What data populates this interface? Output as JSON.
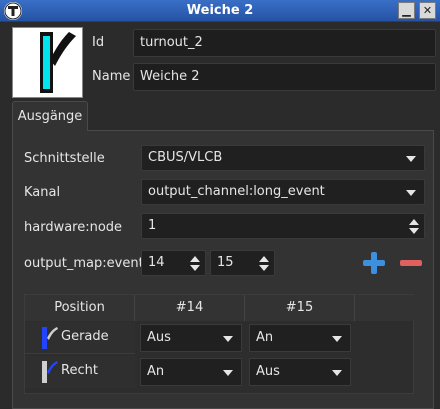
{
  "window": {
    "title": "Weiche 2"
  },
  "fields": {
    "id_label": "Id",
    "id_value": "turnout_2",
    "name_label": "Name",
    "name_value": "Weiche 2"
  },
  "tab": {
    "label": "Ausgänge"
  },
  "form": {
    "interface_label": "Schnittstelle",
    "interface_value": "CBUS/VLCB",
    "channel_label": "Kanal",
    "channel_value": "output_channel:long_event",
    "hardware_label": "hardware:node",
    "hardware_value": "1",
    "output_map_label": "output_map:events",
    "event1": "14",
    "event2": "15"
  },
  "table": {
    "headers": [
      "Position",
      "#14",
      "#15"
    ],
    "rows": [
      {
        "label": "Gerade",
        "c1": "Aus",
        "c2": "An"
      },
      {
        "label": "Recht",
        "c1": "An",
        "c2": "Aus"
      }
    ]
  },
  "colors": {
    "titlebar": "#2553a4",
    "add": "#3d8fe0",
    "remove": "#e06060",
    "switch_cyan": "#00e5ee"
  }
}
